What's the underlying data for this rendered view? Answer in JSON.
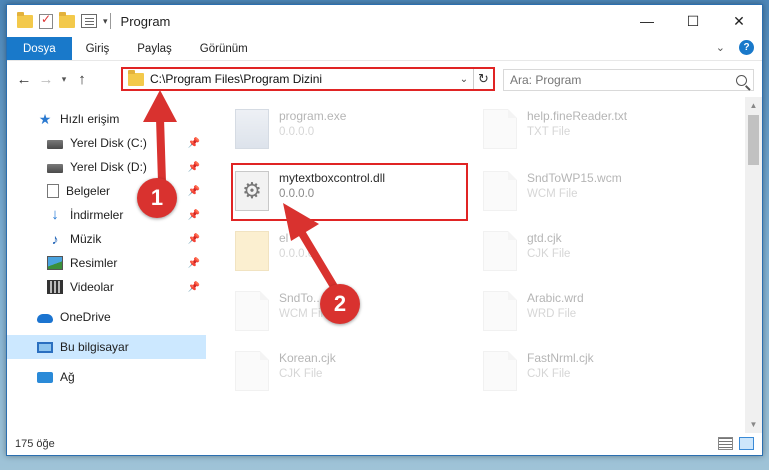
{
  "window": {
    "title": "Program",
    "controls": {
      "minimize": "—",
      "maximize": "☐",
      "close": "✕"
    }
  },
  "ribbon": {
    "tabs": [
      "Dosya",
      "Giriş",
      "Paylaş",
      "Görünüm"
    ],
    "help": "?"
  },
  "address": {
    "path": "C:\\Program Files\\Program Dizini",
    "search_placeholder": "Ara: Program"
  },
  "sidebar": {
    "quick_access": "Hızlı erişim",
    "items": [
      {
        "label": "Yerel Disk (C:)",
        "icon": "disk-icon"
      },
      {
        "label": "Yerel Disk (D:)",
        "icon": "disk-icon"
      },
      {
        "label": "Belgeler",
        "icon": "document-icon"
      },
      {
        "label": "İndirmeler",
        "icon": "download-icon"
      },
      {
        "label": "Müzik",
        "icon": "music-icon"
      },
      {
        "label": "Resimler",
        "icon": "pictures-icon"
      },
      {
        "label": "Videolar",
        "icon": "videos-icon"
      }
    ],
    "onedrive": "OneDrive",
    "this_pc": "Bu bilgisayar",
    "network": "Ağ"
  },
  "files": {
    "left": [
      {
        "name": "program.exe",
        "type": "0.0.0.0"
      },
      {
        "name": "mytextboxcontrol.dll",
        "type": "0.0.0.0"
      },
      {
        "name": "el",
        "type": "0.0.0.0"
      },
      {
        "name": "SndTo...wcm",
        "type": "WCM File"
      },
      {
        "name": "Korean.cjk",
        "type": "CJK File"
      }
    ],
    "right": [
      {
        "name": "help.fineReader.txt",
        "type": "TXT File"
      },
      {
        "name": "SndToWP15.wcm",
        "type": "WCM File"
      },
      {
        "name": "gtd.cjk",
        "type": "CJK File"
      },
      {
        "name": "Arabic.wrd",
        "type": "WRD File"
      },
      {
        "name": "FastNrml.cjk",
        "type": "CJK File"
      }
    ]
  },
  "status": {
    "item_count": "175 öğe"
  },
  "callouts": {
    "one": "1",
    "two": "2"
  },
  "colors": {
    "accent": "#1979ca",
    "highlight": "#e02424",
    "callout": "#d9322f"
  }
}
